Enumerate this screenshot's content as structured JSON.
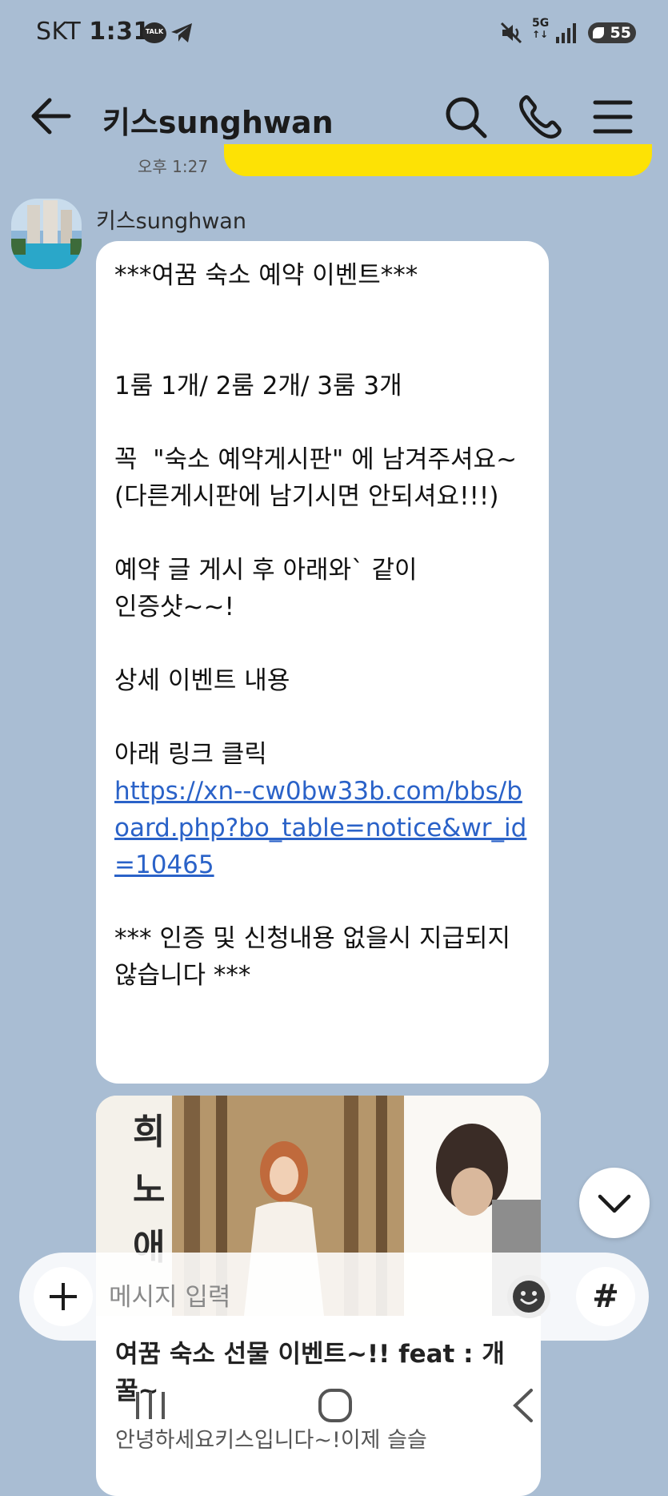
{
  "status": {
    "carrier": "SKT",
    "time": "1:31",
    "network": "5G",
    "battery": "55"
  },
  "header": {
    "title": "키스sunghwan"
  },
  "prev_message": {
    "time": "오후 1:27"
  },
  "message": {
    "sender": "키스sunghwan",
    "text_1": "***여꿈 숙소 예약 이벤트***\n\n\n1룸 1개/ 2룸 2개/ 3룸 3개\n\n꼭  \"숙소 예약게시판\" 에 남겨주셔요~\n(다른게시판에 남기시면 안되셔요!!!)\n\n예약 글 게시 후 아래와` 같이\n인증샷~~!\n\n상세 이벤트 내용\n\n아래 링크 클릭\n",
    "link": "https://xn--cw0bw33b.com/bbs/board.php?bo_table=notice&wr_id=10465",
    "text_2": "\n*** 인증 및 신청내용 없을시 지급되지 않습니다 ***"
  },
  "link_preview": {
    "title": "여꿈 숙소 선물 이벤트~!! feat : 개꿀~",
    "description": "안녕하세요키스입니다~!이제 슬슬",
    "image_text": "희노애"
  },
  "input": {
    "placeholder": "메시지 입력"
  },
  "icons": {
    "back": "arrow-left-icon",
    "search": "search-icon",
    "call": "phone-icon",
    "menu": "hamburger-menu-icon"
  },
  "colors": {
    "background": "#a9bdd3",
    "my_bubble": "#fde205",
    "link": "#2a62c8"
  }
}
